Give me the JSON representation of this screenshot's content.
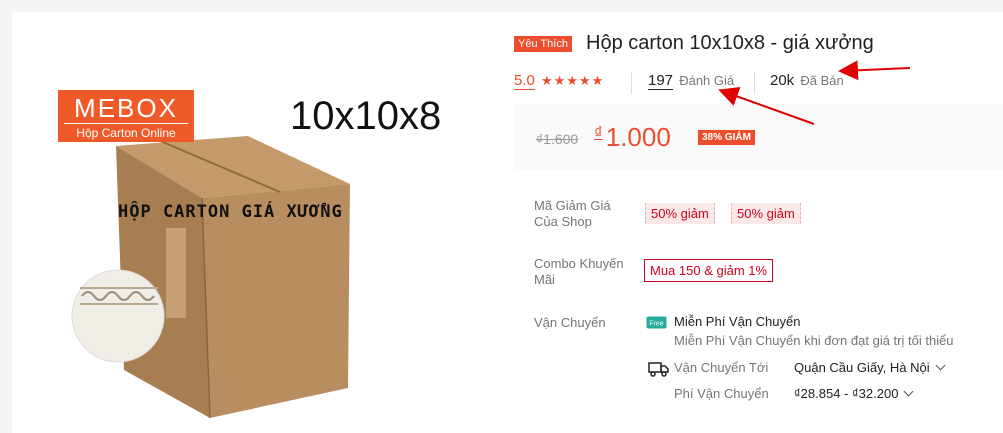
{
  "product_image": {
    "brand": "MEBOX",
    "brand_sub": "Hộp Carton Online",
    "dimensions": "10x10x8",
    "box_text": "HỘP CARTON GIÁ XƯỞNG"
  },
  "product": {
    "badge": "Yêu Thích",
    "title": "Hộp carton 10x10x8 - giá xưởng",
    "rating": "5.0",
    "stars": "★★★★★",
    "reviews_count": "197",
    "reviews_label": "Đánh Giá",
    "sold_count": "20k",
    "sold_label": "Đã Bán"
  },
  "price": {
    "original": "₫1.600",
    "currency": "₫",
    "current": "1.000",
    "discount": "38% GIẢM"
  },
  "vouchers": {
    "label": "Mã Giảm Giá Của Shop",
    "label_line1": "Mã Giảm Giá",
    "label_line2": "Của Shop",
    "items": [
      "50% giảm",
      "50% giảm"
    ]
  },
  "combo": {
    "label_line1": "Combo Khuyến",
    "label_line2": "Mãi",
    "value": "Mua 150 & giảm 1%"
  },
  "shipping": {
    "label": "Vận Chuyển",
    "free_icon_text": "Free",
    "free_title": "Miễn Phí Vận Chuyển",
    "free_desc": "Miễn Phí Vận Chuyển khi đơn đạt giá trị tối thiểu",
    "to_label": "Vận Chuyển Tới",
    "to_value": "Quận Cầu Giấy, Hà Nội",
    "fee_label": "Phí Vận Chuyển",
    "fee_value": "₫28.854 - ₫32.200"
  },
  "colors": {
    "accent": "#ee4d2d",
    "annotation_arrow": "#e00000",
    "cardboard": "#b48a5e"
  }
}
